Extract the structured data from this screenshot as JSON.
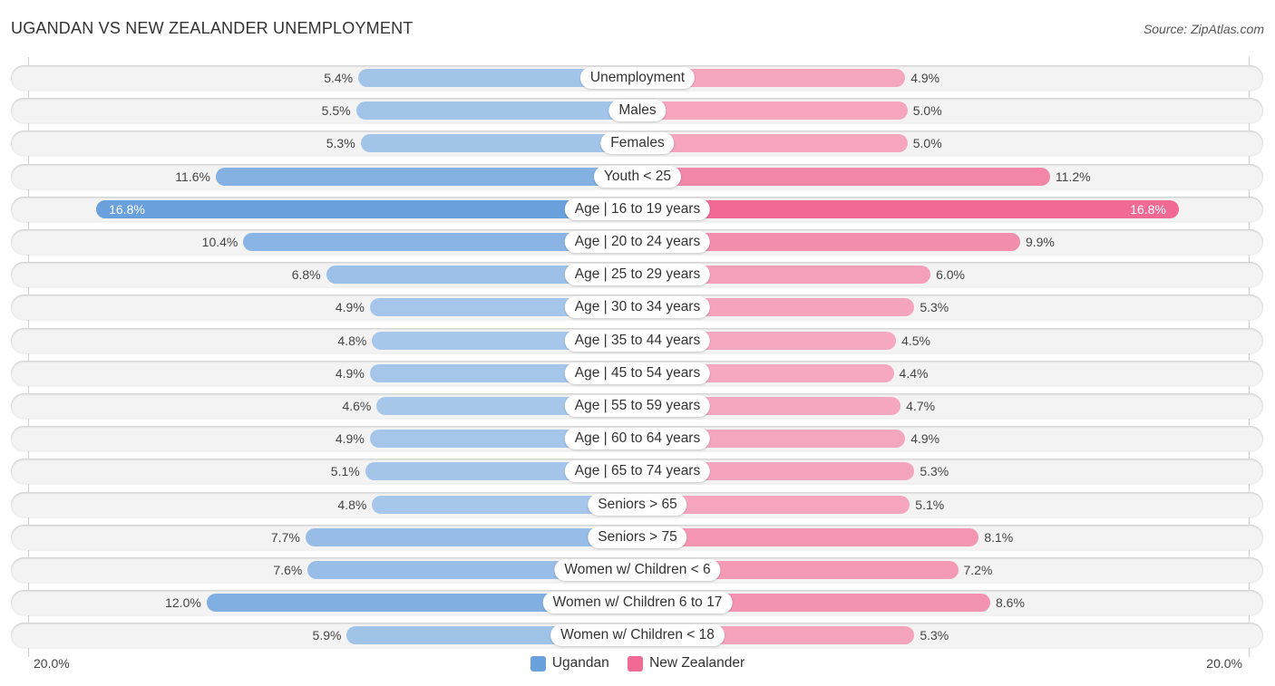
{
  "header": {
    "title": "UGANDAN VS NEW ZEALANDER UNEMPLOYMENT",
    "source": "Source: ZipAtlas.com"
  },
  "colors": {
    "ugandan_light": "#a7c7ea",
    "ugandan_strong": "#6aa0dc",
    "nz_light": "#f5a8c0",
    "nz_strong": "#f06a94"
  },
  "chart_data": {
    "type": "bar",
    "orientation": "horizontal-diverging",
    "title": "UGANDAN VS NEW ZEALANDER UNEMPLOYMENT",
    "unit": "%",
    "xlim": [
      0,
      20.0
    ],
    "axis_tick_left": "20.0%",
    "axis_tick_right": "20.0%",
    "legend_position": "bottom-center",
    "categories": [
      "Unemployment",
      "Males",
      "Females",
      "Youth < 25",
      "Age | 16 to 19 years",
      "Age | 20 to 24 years",
      "Age | 25 to 29 years",
      "Age | 30 to 34 years",
      "Age | 35 to 44 years",
      "Age | 45 to 54 years",
      "Age | 55 to 59 years",
      "Age | 60 to 64 years",
      "Age | 65 to 74 years",
      "Seniors > 65",
      "Seniors > 75",
      "Women w/ Children < 6",
      "Women w/ Children 6 to 17",
      "Women w/ Children < 18"
    ],
    "series": [
      {
        "name": "Ugandan",
        "side": "left",
        "values": [
          5.4,
          5.5,
          5.3,
          11.6,
          16.8,
          10.4,
          6.8,
          4.9,
          4.8,
          4.9,
          4.6,
          4.9,
          5.1,
          4.8,
          7.7,
          7.6,
          12.0,
          5.9
        ],
        "labels": [
          "5.4%",
          "5.5%",
          "5.3%",
          "11.6%",
          "16.8%",
          "10.4%",
          "6.8%",
          "4.9%",
          "4.8%",
          "4.9%",
          "4.6%",
          "4.9%",
          "5.1%",
          "4.8%",
          "7.7%",
          "7.6%",
          "12.0%",
          "5.9%"
        ]
      },
      {
        "name": "New Zealander",
        "side": "right",
        "values": [
          4.9,
          5.0,
          5.0,
          11.2,
          16.8,
          9.9,
          6.0,
          5.3,
          4.5,
          4.4,
          4.7,
          4.9,
          5.3,
          5.1,
          8.1,
          7.2,
          8.6,
          5.3
        ],
        "labels": [
          "4.9%",
          "5.0%",
          "5.0%",
          "11.2%",
          "16.8%",
          "9.9%",
          "6.0%",
          "5.3%",
          "4.5%",
          "4.4%",
          "4.7%",
          "4.9%",
          "5.3%",
          "5.1%",
          "8.1%",
          "7.2%",
          "8.6%",
          "5.3%"
        ]
      }
    ]
  },
  "legend": {
    "items": [
      {
        "label": "Ugandan",
        "color": "#6aa0dc"
      },
      {
        "label": "New Zealander",
        "color": "#f06a94"
      }
    ]
  }
}
